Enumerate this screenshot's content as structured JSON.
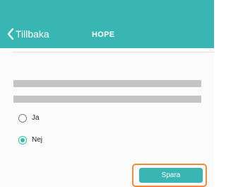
{
  "header": {
    "back_label": "Tillbaka",
    "title": "HOPE",
    "background_color": "#39b6b3"
  },
  "question": {
    "options": [
      {
        "label": "Ja",
        "selected": false
      },
      {
        "label": "Nej",
        "selected": true
      }
    ]
  },
  "actions": {
    "save_label": "Spara",
    "save_button_color": "#39b6b3",
    "highlight_color": "#f28a3c"
  }
}
